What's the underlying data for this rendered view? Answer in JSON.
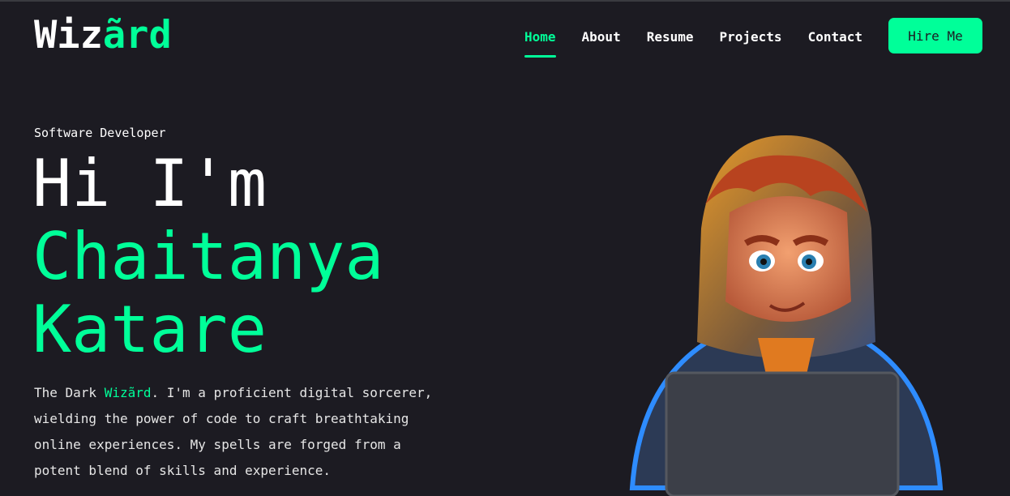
{
  "header": {
    "logo_part1": "Wiz",
    "logo_part2": "ãrd",
    "nav": [
      {
        "label": "Home",
        "active": true
      },
      {
        "label": "About"
      },
      {
        "label": "Resume"
      },
      {
        "label": "Projects"
      },
      {
        "label": "Contact"
      }
    ],
    "cta_label": "Hire Me"
  },
  "hero": {
    "role": "Software Developer",
    "greeting": "Hi I'm",
    "name_line1": "Chaitanya",
    "name_line2": "Katare",
    "desc_before": "The Dark ",
    "desc_highlight": "Wizãrd",
    "desc_after": ". I'm a proficient digital sorcerer, wielding the power of code to craft breathtaking online experiences. My spells are forged from a potent blend of skills and experience."
  },
  "colors": {
    "background": "#1c1b22",
    "accent": "#00ff99",
    "text": "#ffffff"
  },
  "icons": {
    "avatar": "hooded-developer-with-laptop-illustration"
  }
}
